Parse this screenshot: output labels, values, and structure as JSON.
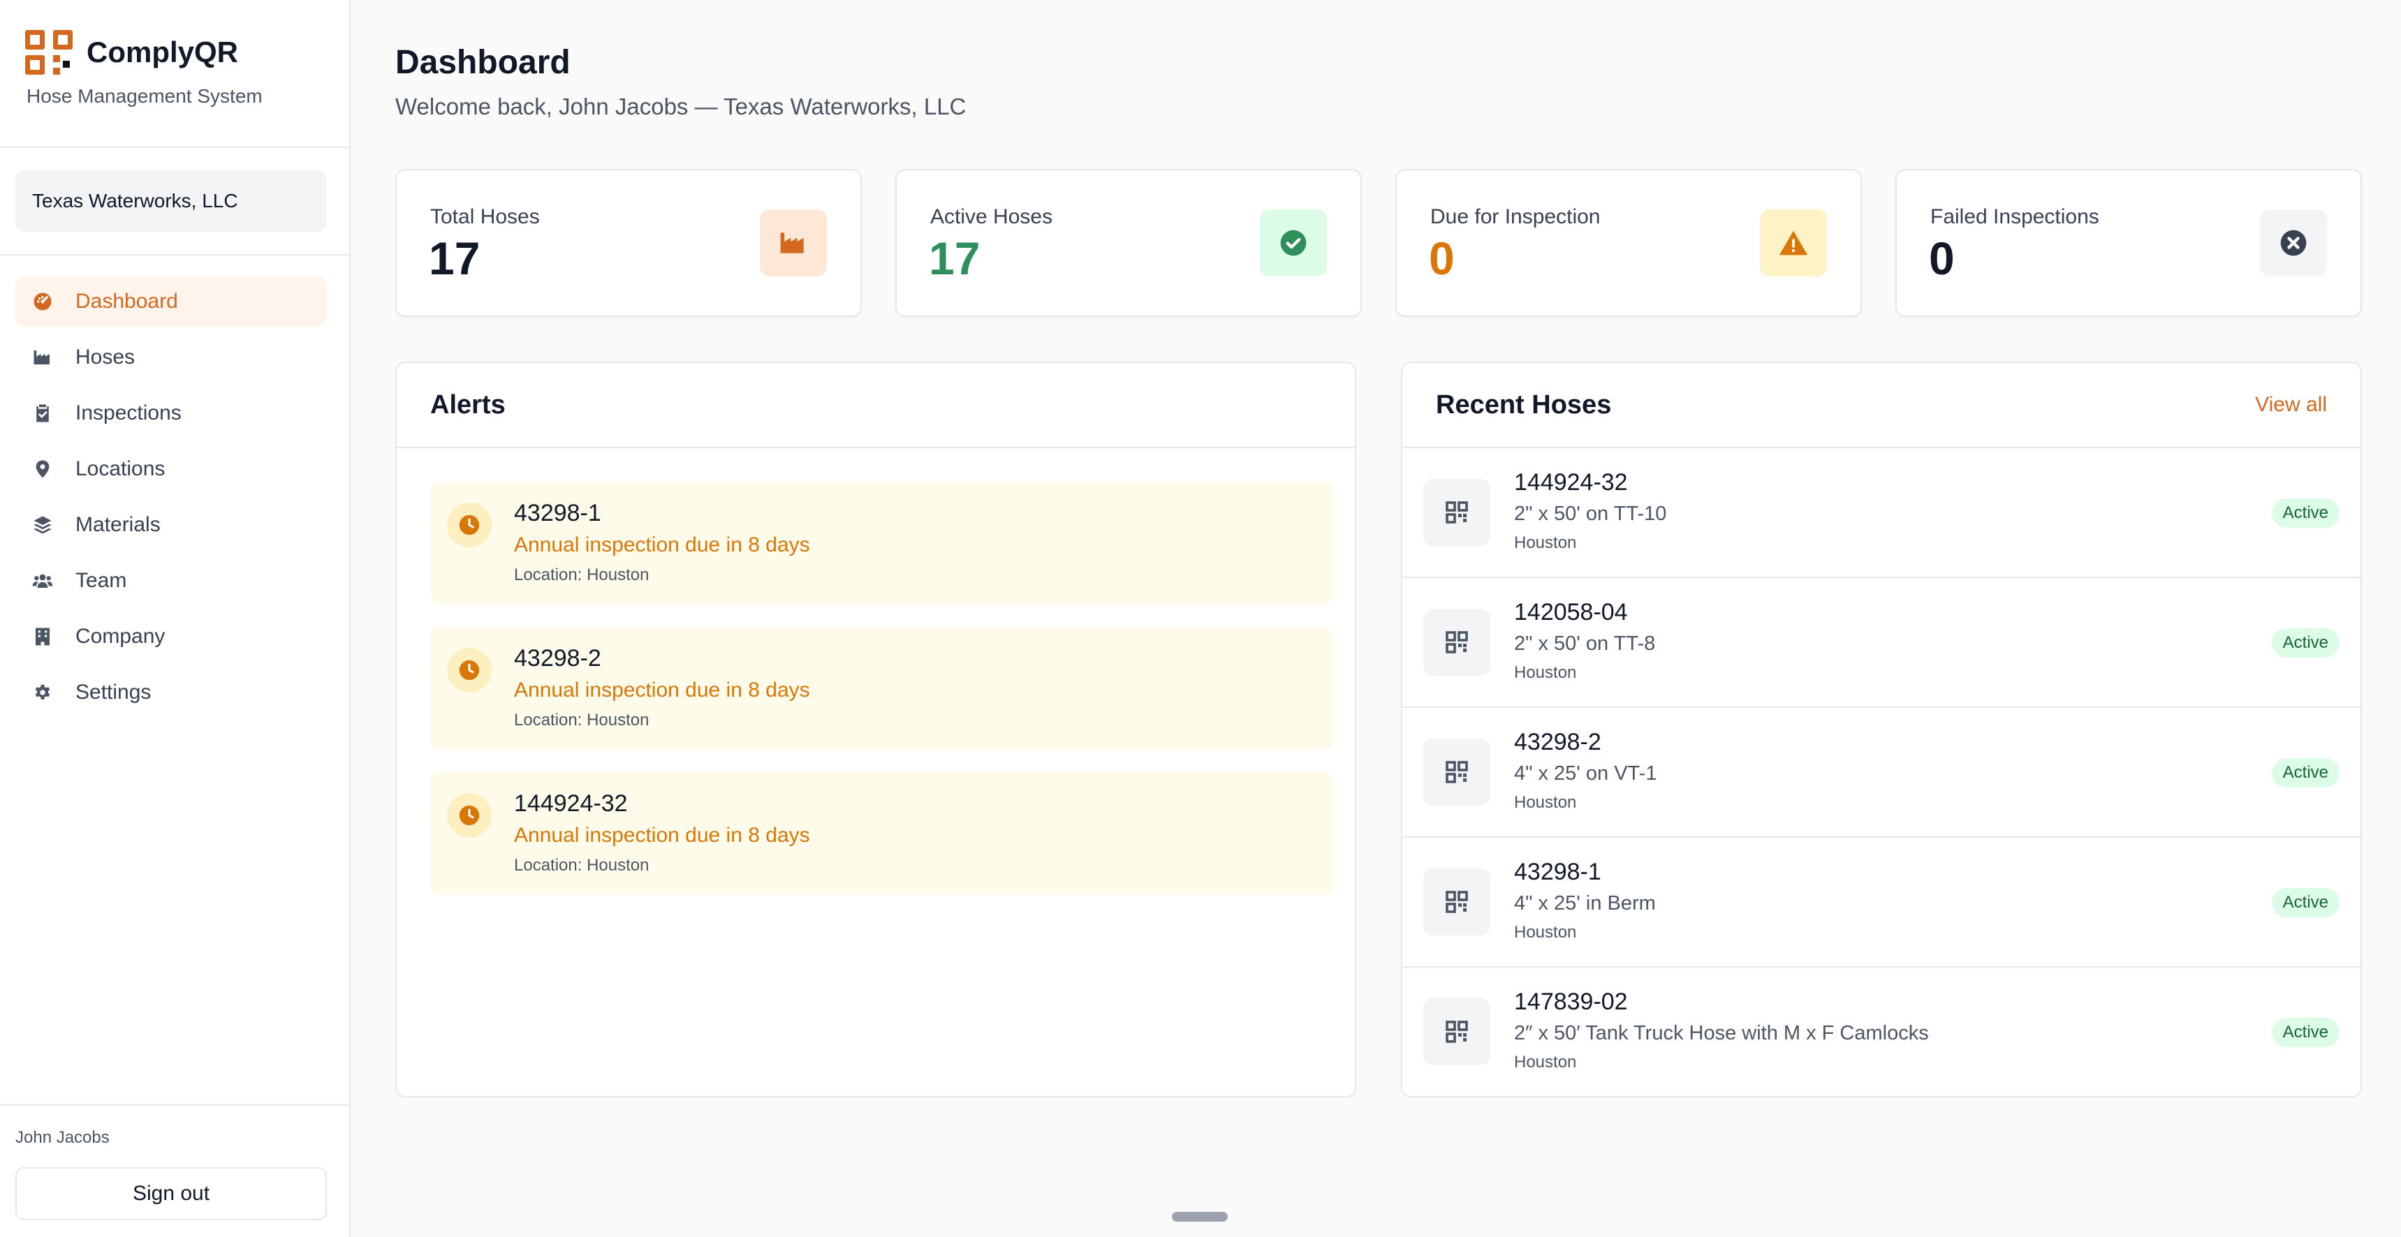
{
  "brand": {
    "name": "ComplyQR",
    "subtitle": "Hose Management System"
  },
  "company_selector": {
    "value": "Texas Waterworks, LLC"
  },
  "nav": [
    {
      "label": "Dashboard",
      "icon": "dashboard-icon",
      "active": true
    },
    {
      "label": "Hoses",
      "icon": "industry-icon",
      "active": false
    },
    {
      "label": "Inspections",
      "icon": "clipboard-check-icon",
      "active": false
    },
    {
      "label": "Locations",
      "icon": "map-pin-icon",
      "active": false
    },
    {
      "label": "Materials",
      "icon": "layers-icon",
      "active": false
    },
    {
      "label": "Team",
      "icon": "users-icon",
      "active": false
    },
    {
      "label": "Company",
      "icon": "building-icon",
      "active": false
    },
    {
      "label": "Settings",
      "icon": "gear-icon",
      "active": false
    }
  ],
  "user": {
    "name": "John Jacobs",
    "signout_label": "Sign out"
  },
  "page": {
    "title": "Dashboard",
    "welcome": "Welcome back, John Jacobs — Texas Waterworks, LLC"
  },
  "stats": [
    {
      "label": "Total Hoses",
      "value": "17",
      "value_color": "#111827",
      "icon": "industry-icon",
      "icon_bg": "#fde8d7",
      "icon_color": "#d2691e"
    },
    {
      "label": "Active Hoses",
      "value": "17",
      "value_color": "#2f8f5b",
      "icon": "check-circle-icon",
      "icon_bg": "#dcfce7",
      "icon_color": "#2f8f5b"
    },
    {
      "label": "Due for Inspection",
      "value": "0",
      "value_color": "#d97706",
      "icon": "warning-icon",
      "icon_bg": "#fef3c7",
      "icon_color": "#d97706"
    },
    {
      "label": "Failed Inspections",
      "value": "0",
      "value_color": "#111827",
      "icon": "x-circle-icon",
      "icon_bg": "#f3f4f6",
      "icon_color": "#374151"
    }
  ],
  "alerts": {
    "title": "Alerts",
    "items": [
      {
        "id": "43298-1",
        "message": "Annual inspection due in 8 days",
        "location": "Location: Houston"
      },
      {
        "id": "43298-2",
        "message": "Annual inspection due in 8 days",
        "location": "Location: Houston"
      },
      {
        "id": "144924-32",
        "message": "Annual inspection due in 8 days",
        "location": "Location: Houston"
      }
    ]
  },
  "recent_hoses": {
    "title": "Recent Hoses",
    "view_all_label": "View all",
    "items": [
      {
        "id": "144924-32",
        "description": "2\" x 50' on TT-10",
        "location": "Houston",
        "status": "Active"
      },
      {
        "id": "142058-04",
        "description": "2\" x 50' on TT-8",
        "location": "Houston",
        "status": "Active"
      },
      {
        "id": "43298-2",
        "description": "4\" x 25' on VT-1",
        "location": "Houston",
        "status": "Active"
      },
      {
        "id": "43298-1",
        "description": "4\" x 25' in Berm",
        "location": "Houston",
        "status": "Active"
      },
      {
        "id": "147839-02",
        "description": "2″ x 50′ Tank Truck Hose with M x F Camlocks",
        "location": "Houston",
        "status": "Active"
      }
    ]
  },
  "colors": {
    "accent": "#d2691e",
    "warning": "#d97706",
    "success": "#2f8f5b"
  }
}
